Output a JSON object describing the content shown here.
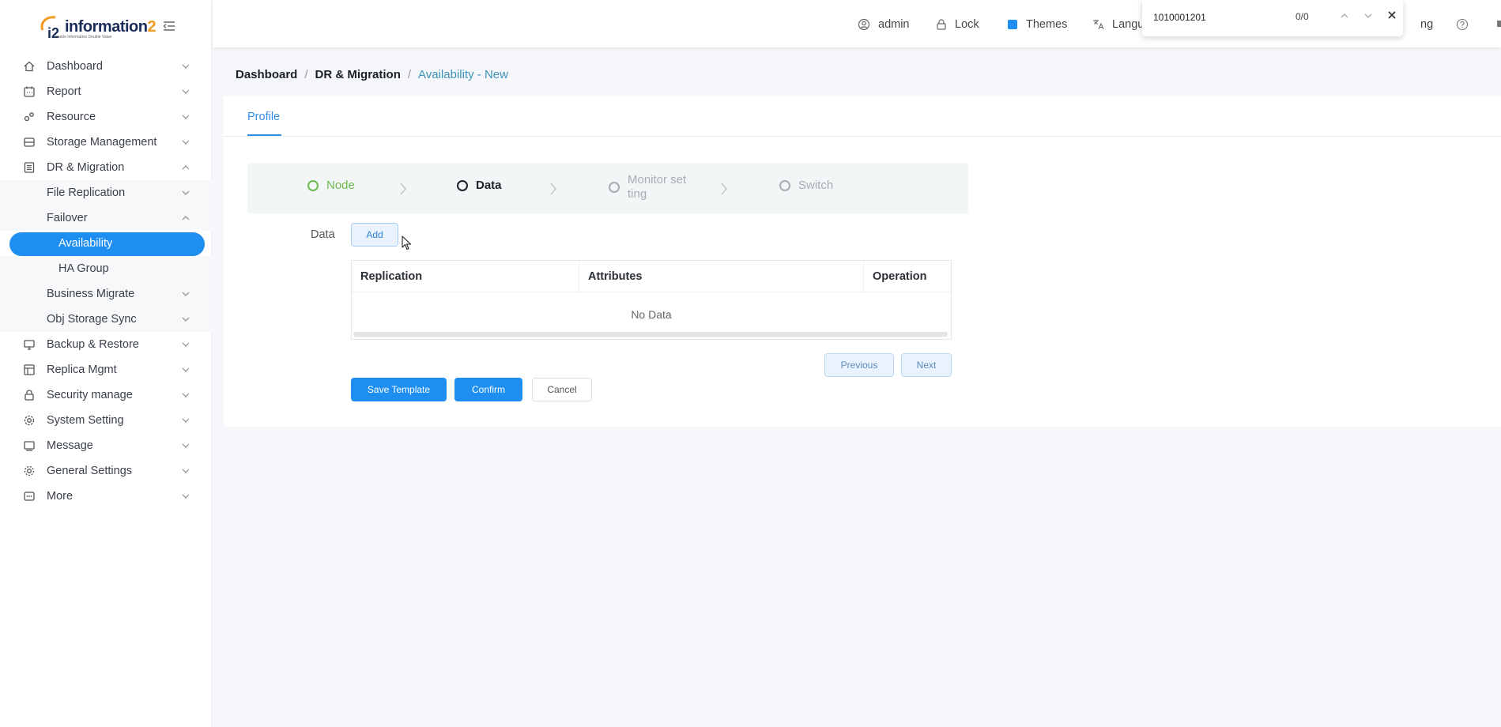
{
  "brand": {
    "name_main": "information",
    "name_suffix": "2",
    "tagline": "Double Information Double Value"
  },
  "colors": {
    "accent": "#1f8ef1",
    "step_done": "#6dbb4f",
    "breadcrumb_current": "#3c92b8"
  },
  "sidebar": {
    "items": [
      {
        "label": "Dashboard",
        "icon": "home-icon",
        "chevron": "down"
      },
      {
        "label": "Report",
        "icon": "report-icon",
        "chevron": "down"
      },
      {
        "label": "Resource",
        "icon": "resource-icon",
        "chevron": "down"
      },
      {
        "label": "Storage Management",
        "icon": "storage-icon",
        "chevron": "down"
      },
      {
        "label": "DR & Migration",
        "icon": "dr-migration-icon",
        "chevron": "up"
      },
      {
        "label": "File Replication",
        "chevron": "down"
      },
      {
        "label": "Failover",
        "chevron": "up"
      },
      {
        "label": "Availability"
      },
      {
        "label": "HA Group"
      },
      {
        "label": "Business Migrate",
        "chevron": "down"
      },
      {
        "label": "Obj Storage Sync",
        "chevron": "down"
      },
      {
        "label": "Backup & Restore",
        "icon": "backup-icon",
        "chevron": "down"
      },
      {
        "label": "Replica Mgmt",
        "icon": "replica-icon",
        "chevron": "down"
      },
      {
        "label": "Security manage",
        "icon": "lock-icon",
        "chevron": "down"
      },
      {
        "label": "System Setting",
        "icon": "gear-icon",
        "chevron": "down"
      },
      {
        "label": "Message",
        "icon": "message-icon",
        "chevron": "down"
      },
      {
        "label": "General Settings",
        "icon": "settings-icon",
        "chevron": "down"
      },
      {
        "label": "More",
        "icon": "more-icon",
        "chevron": "down"
      }
    ]
  },
  "header": {
    "user": "admin",
    "lock": "Lock",
    "themes": "Themes",
    "language": "Langu",
    "partial_right": "ng"
  },
  "findbar": {
    "query": "1010001201",
    "count": "0/0"
  },
  "breadcrumb": {
    "items": [
      "Dashboard",
      "DR & Migration",
      "Availability - New"
    ]
  },
  "tabs": {
    "profile": "Profile"
  },
  "steps": [
    {
      "label": "Node",
      "state": "done"
    },
    {
      "label": "Data",
      "state": "current"
    },
    {
      "label_line1": "Monitor set",
      "label_line2": "ting",
      "state": "pending"
    },
    {
      "label": "Switch",
      "state": "pending"
    }
  ],
  "form": {
    "data_label": "Data",
    "add_button": "Add"
  },
  "table": {
    "columns": [
      "Replication",
      "Attributes",
      "Operation"
    ],
    "empty_text": "No Data"
  },
  "actions": {
    "previous": "Previous",
    "next": "Next",
    "save_template": "Save Template",
    "confirm": "Confirm",
    "cancel": "Cancel"
  }
}
